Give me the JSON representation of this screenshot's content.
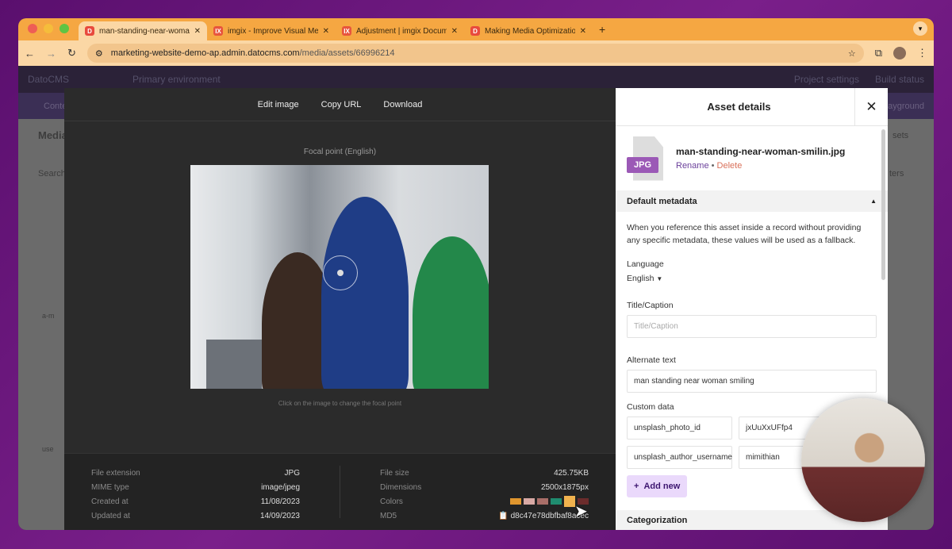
{
  "browser": {
    "tabs": [
      {
        "title": "man-standing-near-woman-s",
        "icon": "D",
        "color": "#e84a3d",
        "active": true
      },
      {
        "title": "imgix - Improve Visual Media",
        "icon": "IX",
        "color": "#e8553d"
      },
      {
        "title": "Adjustment | imgix Documen",
        "icon": "IX",
        "color": "#e8553d"
      },
      {
        "title": "Making Media Optimization a",
        "icon": "D",
        "color": "#e84a3d"
      }
    ],
    "url_host": "marketing-website-demo-ap.admin.datocms.com",
    "url_path": "/media/assets/66996214"
  },
  "app": {
    "brand": "DatoCMS",
    "environment": "Primary environment",
    "project_settings": "Project settings",
    "build_status": "Build status",
    "nav_content": "Conte",
    "playground": "ayground",
    "media_title": "Media",
    "search": "Search",
    "assets": "sets",
    "filters": "ters",
    "item1": "a-m",
    "item2": "use"
  },
  "modal": {
    "toolbar": [
      "Edit image",
      "Copy URL",
      "Download"
    ],
    "focal_label": "Focal point (English)",
    "hint": "Click on the image to change the focal point",
    "meta_left": [
      {
        "k": "File extension",
        "v": "JPG"
      },
      {
        "k": "MIME type",
        "v": "image/jpeg"
      },
      {
        "k": "Created at",
        "v": "11/08/2023"
      },
      {
        "k": "Updated at",
        "v": "14/09/2023"
      }
    ],
    "meta_right": {
      "file_size_label": "File size",
      "file_size": "425.75KB",
      "dimensions_label": "Dimensions",
      "dimensions": "2500x1875px",
      "colors_label": "Colors",
      "colors": [
        "#e0962e",
        "#d8a9a4",
        "#a96e68",
        "#1f8c6f",
        "#f0b24e",
        "#6b2c2c"
      ],
      "md5_label": "MD5",
      "md5": "d8c47e78dbfbaf8acec"
    }
  },
  "panel": {
    "title": "Asset details",
    "file_badge": "JPG",
    "filename": "man-standing-near-woman-smilin.jpg",
    "rename": "Rename",
    "sep": " • ",
    "delete": "Delete",
    "section": "Default metadata",
    "description": "When you reference this asset inside a record without providing any specific metadata, these values will be used as a fallback.",
    "language_label": "Language",
    "language": "English",
    "title_label": "Title/Caption",
    "title_placeholder": "Title/Caption",
    "alt_label": "Alternate text",
    "alt_value": "man standing near woman smiling",
    "custom_label": "Custom data",
    "custom": [
      {
        "k": "unsplash_photo_id",
        "v": "jxUuXxUFfp4"
      },
      {
        "k": "unsplash_author_username",
        "v": "mimithian"
      }
    ],
    "add_new": "Add new",
    "categorization": "Categorization"
  }
}
